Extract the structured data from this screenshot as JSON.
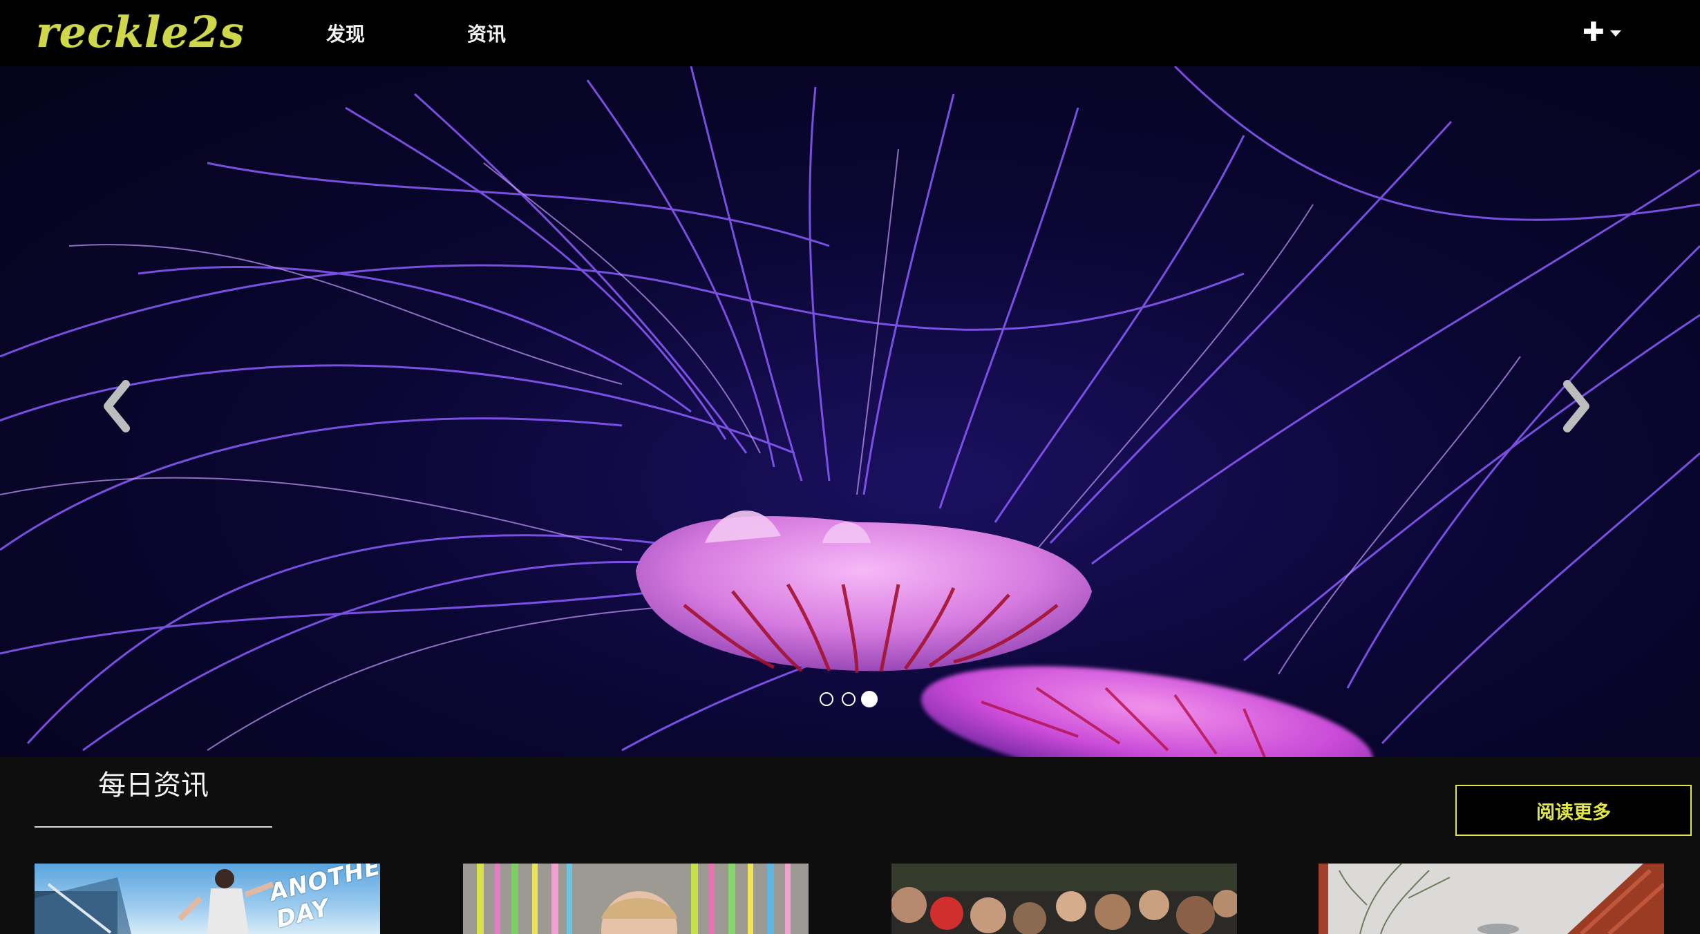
{
  "brand": {
    "logo_text": "reckle2s",
    "accent_color": "#cfd84a"
  },
  "nav": {
    "items": [
      {
        "label": "发现"
      },
      {
        "label": "资讯"
      }
    ],
    "add_menu": {
      "icon": "plus-icon",
      "dropdown_icon": "caret-down-icon"
    }
  },
  "carousel": {
    "image": "jellyfish-photo",
    "prev_icon": "chevron-left-icon",
    "next_icon": "chevron-right-icon",
    "slide_count": 3,
    "active_slide": 3
  },
  "news": {
    "title": "每日资讯",
    "read_more_label": "阅读更多",
    "cards": [
      {
        "image": "skateboarder-photo",
        "caption": "ANOTHER DAY"
      },
      {
        "image": "colorful-tubes-photo"
      },
      {
        "image": "crowd-photo"
      },
      {
        "image": "bridge-winter-photo"
      }
    ]
  },
  "colors": {
    "nav_background": "#000000",
    "page_background": "#0e0e0e",
    "button_accent": "#e1e64a"
  }
}
